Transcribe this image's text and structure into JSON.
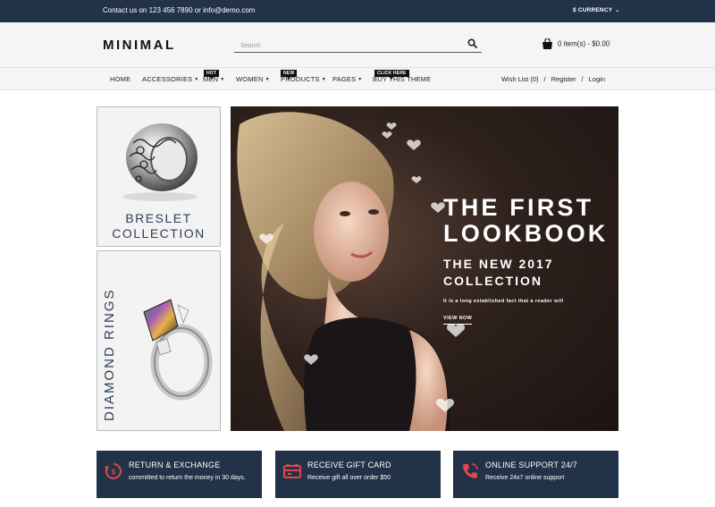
{
  "topbar": {
    "contact": "Contact us on 123 456 7890 or info@demo.com",
    "currency": "$ CURRENCY"
  },
  "header": {
    "logo": "MINIMAL",
    "search_placeholder": "Search",
    "cart": "0 item(s) - $0.00"
  },
  "nav": {
    "items": [
      {
        "label": "HOME",
        "caret": false
      },
      {
        "label": "ACCESSORIES",
        "caret": true
      },
      {
        "label": "MEN",
        "caret": true,
        "badge": "HOT"
      },
      {
        "label": "WOMEN",
        "caret": true
      },
      {
        "label": "PRODUCTS",
        "caret": true,
        "badge": "NEW"
      },
      {
        "label": "PAGES",
        "caret": true
      },
      {
        "label": "BUY THIS THEME",
        "caret": false,
        "badge": "CLICK HERE"
      }
    ],
    "wishlist": "Wish List (0)",
    "register": "Register",
    "login": "Login",
    "separator": "/"
  },
  "promos": {
    "bracelet_line1": "BRESLET",
    "bracelet_line2": "COLLECTION",
    "rings": "DIAMOND RINGS"
  },
  "banner": {
    "headline_line1": "THE FIRST",
    "headline_line2": "LOOKBOOK",
    "sub_line1": "THE NEW 2017",
    "sub_line2": "COLLECTION",
    "description": "It is a long established fact that a reader will",
    "cta": "VIEW NOW"
  },
  "features": [
    {
      "title": "RETURN & EXCHANGE",
      "desc": "committed to return the money in 30 days.",
      "icon": "return-icon"
    },
    {
      "title": "RECEIVE GIFT CARD",
      "desc": "Receive gift all over order $50",
      "icon": "gift-card-icon"
    },
    {
      "title": "ONLINE SUPPORT 24/7",
      "desc": "Receive 24x7 online support",
      "icon": "phone-icon"
    }
  ],
  "colors": {
    "navy": "#223249",
    "accent": "#e0474c"
  }
}
